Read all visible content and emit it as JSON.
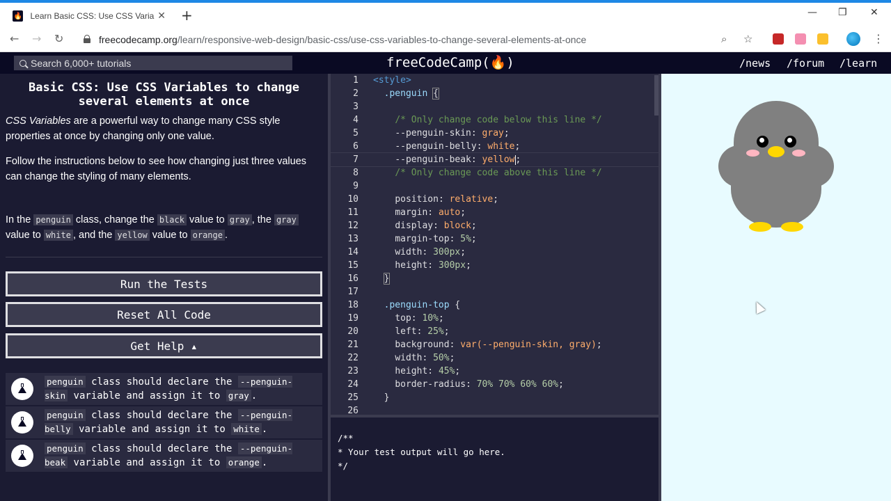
{
  "browser": {
    "tab_title": "Learn Basic CSS: Use CSS Variables to Change Several Elements at Once",
    "url_host": "freecodecamp.org",
    "url_path": "/learn/responsive-web-design/basic-css/use-css-variables-to-change-several-elements-at-once"
  },
  "navbar": {
    "search_placeholder": "Search 6,000+ tutorials",
    "logo": "freeCodeCamp(🔥)",
    "links": [
      "/news",
      "/forum",
      "/learn"
    ]
  },
  "challenge": {
    "title": "Basic CSS: Use CSS Variables to change several elements at once",
    "intro_em": "CSS Variables",
    "intro_rest": " are a powerful way to change many CSS style properties at once by changing only one value.",
    "follow": "Follow the instructions below to see how changing just three values can change the styling of many elements.",
    "instr": {
      "a": "In the ",
      "code1": "penguin",
      "b": " class, change the ",
      "code2": "black",
      "c": " value to ",
      "code3": "gray",
      "d": ", the ",
      "code4": "gray",
      "e": " value to ",
      "code5": "white",
      "f": ", and the ",
      "code6": "yellow",
      "g": " value to ",
      "code7": "orange",
      "h": "."
    }
  },
  "buttons": {
    "run": "Run the Tests",
    "reset": "Reset All Code",
    "help": "Get Help ▴"
  },
  "tests": [
    {
      "code1": "penguin",
      "t1": " class should declare the ",
      "code2": "--penguin-skin",
      "t2": " variable and assign it to ",
      "code3": "gray",
      "t3": "."
    },
    {
      "code1": "penguin",
      "t1": " class should declare the ",
      "code2": "--penguin-belly",
      "t2": " variable and assign it to ",
      "code3": "white",
      "t3": "."
    },
    {
      "code1": "penguin",
      "t1": " class should declare the ",
      "code2": "--penguin-beak",
      "t2": " variable and assign it to ",
      "code3": "orange",
      "t3": "."
    }
  ],
  "editor": {
    "line_numbers": [
      "1",
      "2",
      "3",
      "4",
      "5",
      "6",
      "7",
      "8",
      "9",
      "10",
      "11",
      "12",
      "13",
      "14",
      "15",
      "16",
      "17",
      "18",
      "19",
      "20",
      "21",
      "22",
      "23",
      "24",
      "25",
      "26"
    ],
    "lines": {
      "l1": "<style>",
      "l2_sel": ".penguin",
      "l2_brace": "{",
      "l4": "/* Only change code below this line */",
      "l5_prop": "--penguin-skin",
      "l5_val": "gray",
      "l6_prop": "--penguin-belly",
      "l6_val": "white",
      "l7_prop": "--penguin-beak",
      "l7_val": "yellow",
      "l8": "/* Only change code above this line */",
      "l10_prop": "position",
      "l10_val": "relative",
      "l11_prop": "margin",
      "l11_val": "auto",
      "l12_prop": "display",
      "l12_val": "block",
      "l13_prop": "margin-top",
      "l13_val": "5%",
      "l14_prop": "width",
      "l14_val": "300px",
      "l15_prop": "height",
      "l15_val": "300px",
      "l16": "}",
      "l18_sel": ".penguin-top",
      "l18_brace": "{",
      "l19_prop": "top",
      "l19_val": "10%",
      "l20_prop": "left",
      "l20_val": "25%",
      "l21_prop": "background",
      "l21_val": "var(--penguin-skin, gray)",
      "l22_prop": "width",
      "l22_val": "50%",
      "l23_prop": "height",
      "l23_val": "45%",
      "l24_prop": "border-radius",
      "l24_val": "70% 70% 60% 60%",
      "l25": "}"
    }
  },
  "console": {
    "lines": [
      "/**",
      "* Your test output will go here.",
      "*/"
    ]
  },
  "colors": {
    "fcc_dark": "#0a0a23",
    "panel_bg": "#1b1b32",
    "editor_bg": "#2a2a40",
    "preview_bg": "#e8fbff",
    "penguin_skin": "#808080",
    "penguin_beak": "#ffd700"
  }
}
